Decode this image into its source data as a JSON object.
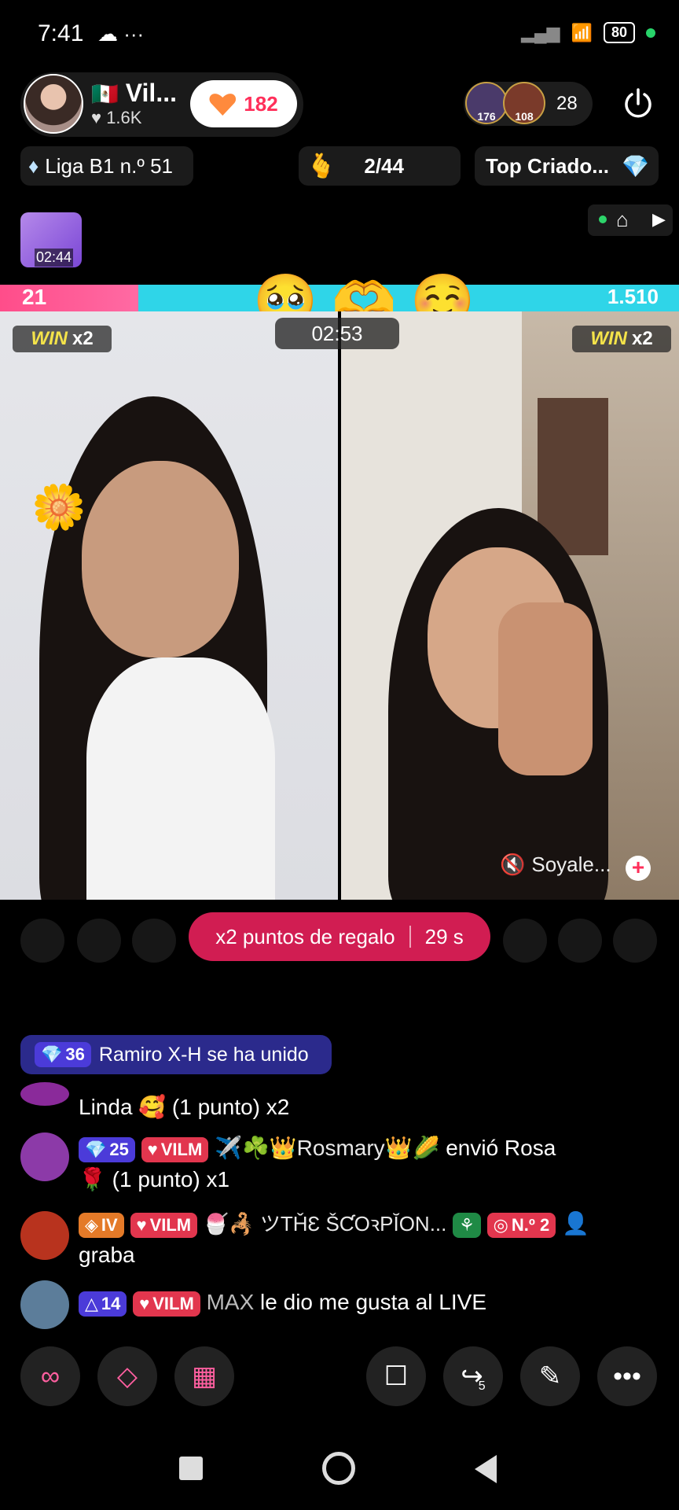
{
  "status_bar": {
    "time": "7:41",
    "battery": "80"
  },
  "host": {
    "name": "Vil...",
    "likes": "1.6K",
    "follow_count": "182"
  },
  "viewers": {
    "badge1": "176",
    "badge2": "108",
    "count": "28"
  },
  "info_row": {
    "league": "Liga B1 n.º 51",
    "rank": "2/44",
    "top": "Top Criado..."
  },
  "gift_timer": "02:44",
  "battle": {
    "score_left": "21",
    "score_right": "1.510",
    "timer": "02:53",
    "emojis": [
      "🥹",
      "🫶",
      "☺️"
    ],
    "win_left": "x2",
    "win_right": "x2",
    "win_label": "WIN"
  },
  "guest": {
    "tag": "Soyale..."
  },
  "boost": {
    "label": "x2 puntos de regalo",
    "seconds": "29 s"
  },
  "chat": {
    "joined": {
      "level": "36",
      "text": "Ramiro X-H se ha unido"
    },
    "messages": [
      {
        "text": "Linda 🥰 (1 punto) x2"
      },
      {
        "level": "25",
        "vilm": "VILM",
        "name": "✈️☘️👑Rosmary👑🌽",
        "text": " envió Rosa",
        "text2": "🌹 (1 punto) x1"
      },
      {
        "level": "IV",
        "vilm": "VILM",
        "name": "🍧🦂 ツTȞƐ ŠƇOꝛPĬON...",
        "rank": "N.º 2",
        "text": "graba"
      },
      {
        "level": "14",
        "vilm": "VILM",
        "name": "MAX",
        "text": " le dio me gusta al LIVE"
      }
    ]
  },
  "toolbar": {
    "share_count": "5"
  },
  "icons": [
    "cloud-icon",
    "wifi-icon",
    "power-icon",
    "diamond-icon",
    "gift-icon",
    "home-icon",
    "mute-icon",
    "link-icon",
    "multi-guest-icon",
    "apps-icon",
    "comment-icon",
    "share-icon",
    "effects-icon",
    "more-icon"
  ]
}
